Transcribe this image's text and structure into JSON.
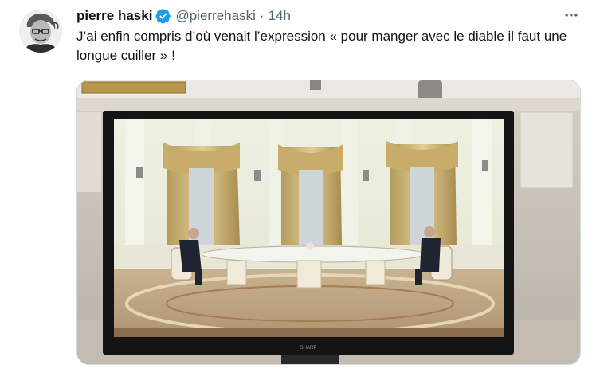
{
  "tweet": {
    "author": {
      "display_name": "pierre haski",
      "handle": "@pierrehaski",
      "verified": true,
      "avatar_icon": "user-portrait-avatar"
    },
    "separator": "·",
    "time_ago": "14h",
    "more_icon": "more-horizontal-icon",
    "text": "J’ai enfin compris d’où venait l’expression « pour manger avec le diable il faut une longue cuiller » !",
    "media": {
      "type": "photo",
      "tv_brand": "SHARP"
    },
    "colors": {
      "verified_blue": "#1d9bf0",
      "secondary_text": "#536471",
      "border": "#cfd9de"
    }
  }
}
